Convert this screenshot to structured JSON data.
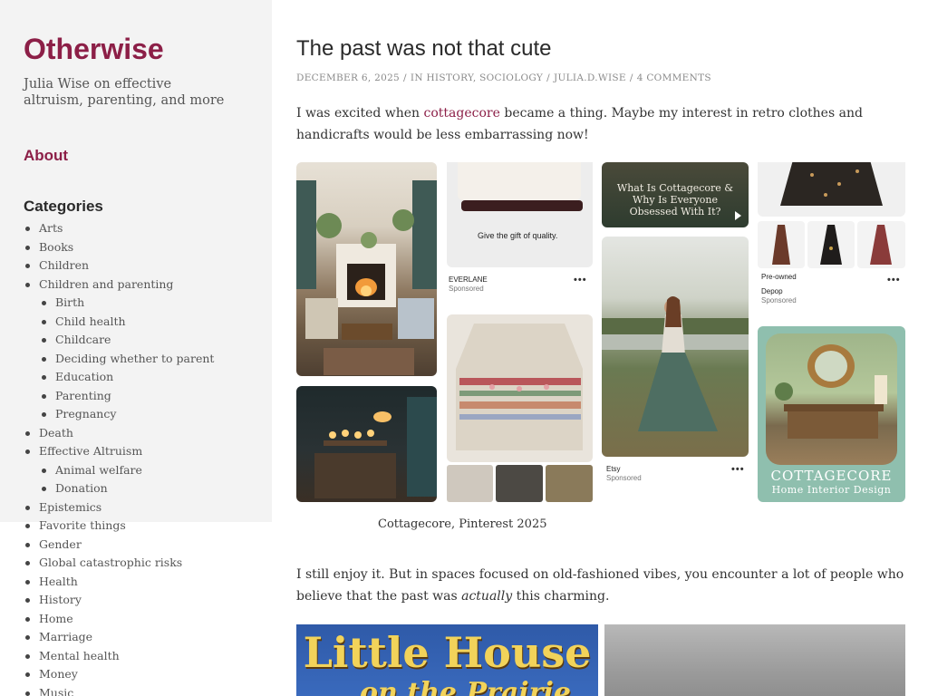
{
  "site": {
    "title": "Otherwise",
    "description": "Julia Wise on effective altruism, parenting, and more"
  },
  "sidebar": {
    "about_label": "About",
    "categories_heading": "Categories",
    "categories": [
      {
        "label": "Arts",
        "level": 0
      },
      {
        "label": "Books",
        "level": 0
      },
      {
        "label": "Children",
        "level": 0
      },
      {
        "label": "Children and parenting",
        "level": 0
      },
      {
        "label": "Birth",
        "level": 1
      },
      {
        "label": "Child health",
        "level": 1
      },
      {
        "label": "Childcare",
        "level": 1
      },
      {
        "label": "Deciding whether to parent",
        "level": 1
      },
      {
        "label": "Education",
        "level": 1
      },
      {
        "label": "Parenting",
        "level": 1
      },
      {
        "label": "Pregnancy",
        "level": 1
      },
      {
        "label": "Death",
        "level": 0
      },
      {
        "label": "Effective Altruism",
        "level": 0
      },
      {
        "label": "Animal welfare",
        "level": 1
      },
      {
        "label": "Donation",
        "level": 1
      },
      {
        "label": "Epistemics",
        "level": 0
      },
      {
        "label": "Favorite things",
        "level": 0
      },
      {
        "label": "Gender",
        "level": 0
      },
      {
        "label": "Global catastrophic risks",
        "level": 0
      },
      {
        "label": "Health",
        "level": 0
      },
      {
        "label": "History",
        "level": 0
      },
      {
        "label": "Home",
        "level": 0
      },
      {
        "label": "Marriage",
        "level": 0
      },
      {
        "label": "Mental health",
        "level": 0
      },
      {
        "label": "Money",
        "level": 0
      },
      {
        "label": "Music",
        "level": 0
      }
    ]
  },
  "post": {
    "title": "The past was not that cute",
    "meta": {
      "date": "December 6, 2025",
      "in_label": "In",
      "cat1": "History",
      "cat2": "Sociology",
      "author": "julia.d.wise",
      "comments": "4 Comments"
    },
    "para1_before": "I was excited when ",
    "para1_link": "cottagecore",
    "para1_after": " became a thing. Maybe my interest in retro clothes and handicrafts would be less embarrassing now!",
    "caption": "Cottagecore, Pinterest 2025",
    "para2_before": "I still enjoy it. But in spaces focused on old-fashioned vibes, you encounter a lot of people who believe that the past was ",
    "para2_em": "actually",
    "para2_after": " this charming."
  },
  "collage": {
    "ad1_text": "Give the gift of quality.",
    "ad1_brand": "EVERLANE",
    "ad1_sponsored": "Sponsored",
    "video_line1": "What Is Cottagecore &",
    "video_line2": "Why Is Everyone",
    "video_line3": "Obsessed With It?",
    "ad2_tag": "Pre-owned",
    "ad2_brand": "Depop",
    "ad2_sponsored": "Sponsored",
    "ad3_brand": "Etsy",
    "ad3_sponsored": "Sponsored",
    "banner_line1": "COTTAGECORE",
    "banner_line2": "Home Interior Design",
    "dots": "•••"
  },
  "book": {
    "title": "Little House",
    "subtitle": "on the Prairie"
  },
  "colors": {
    "accent": "#8c1f47",
    "sidebar_bg": "#f3f3f3",
    "text": "#333333"
  }
}
